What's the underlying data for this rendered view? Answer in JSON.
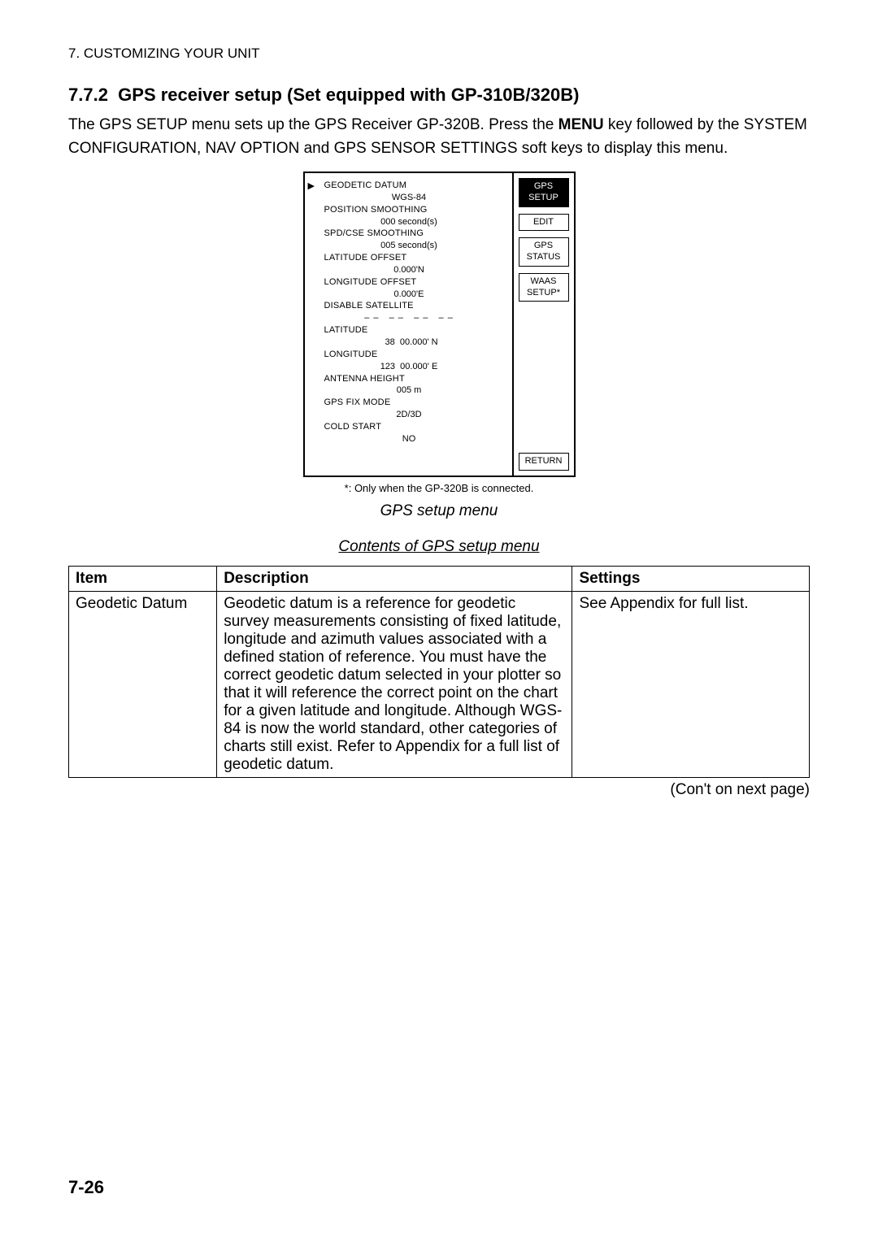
{
  "header": {
    "section": "7. CUSTOMIZING YOUR UNIT"
  },
  "heading": {
    "num": "7.7.2",
    "title": "GPS receiver setup (Set equipped with GP-310B/320B)"
  },
  "intro": {
    "p1a": "The GPS SETUP menu sets up the GPS Receiver GP-320B. Press the ",
    "p1b": "MENU",
    "p1c": " key followed by the SYSTEM CONFIGURATION, NAV OPTION and GPS SENSOR SETTINGS soft keys to display this menu."
  },
  "menu": {
    "items": [
      {
        "label": "GEODETIC DATUM",
        "value": "WGS-84"
      },
      {
        "label": "POSITION SMOOTHING",
        "value": "000 second(s)"
      },
      {
        "label": "SPD/CSE SMOOTHING",
        "value": "005 second(s)"
      },
      {
        "label": "LATITUDE OFFSET",
        "value": "0.000'N"
      },
      {
        "label": "LONGITUDE OFFSET",
        "value": "0.000'E"
      },
      {
        "label": "DISABLE SATELLITE",
        "value": "– –   – –   – –   – –"
      },
      {
        "label": "LATITUDE",
        "value": "  38  00.000' N"
      },
      {
        "label": "LONGITUDE",
        "value": "123  00.000' E"
      },
      {
        "label": "ANTENNA HEIGHT",
        "value": "005 m"
      },
      {
        "label": "GPS FIX MODE",
        "value": "2D/3D"
      },
      {
        "label": "COLD START",
        "value": "NO"
      }
    ],
    "softkeys": {
      "active": "GPS\nSETUP",
      "edit": "EDIT",
      "status": "GPS\nSTATUS",
      "waas": "WAAS\nSETUP*",
      "return": "RETURN"
    },
    "footnote": "*: Only when the GP-320B is connected.",
    "caption": "GPS setup menu"
  },
  "table": {
    "title": "Contents of GPS setup menu",
    "headers": {
      "c1": "Item",
      "c2": "Description",
      "c3": "Settings"
    },
    "row": {
      "item": "Geodetic Datum",
      "desc": "Geodetic datum is a reference for geodetic survey measurements consisting of fixed latitude, longitude and azimuth values associated with a defined station of reference. You must have the correct geodetic datum selected in your plotter so that it will reference the correct point on the chart for a given latitude and longitude. Although WGS-84 is now the world standard, other categories of charts still exist. Refer to Appendix for a full list of geodetic datum.",
      "settings": "See Appendix for full list."
    },
    "continued": "(Con't on next page)"
  },
  "pagenum": "7-26"
}
